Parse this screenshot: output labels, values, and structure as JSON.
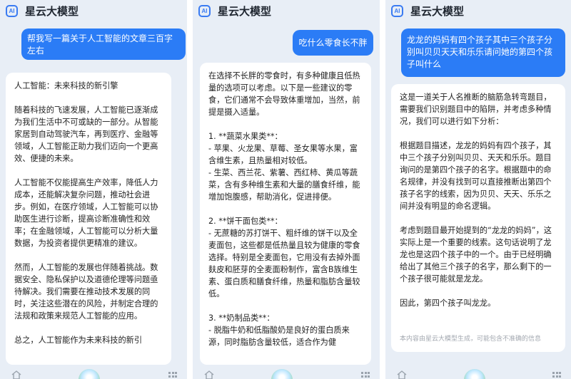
{
  "app": {
    "title": "星云大模型",
    "icon_text": "AI"
  },
  "panels": [
    {
      "prompt": "帮我写一篇关于人工智能的文章三百字\n左右",
      "answer": "人工智能：未来科技的新引擎\n\n随着科技的飞速发展，人工智能已逐渐成为我们生活中不可或缺的一部分。从智能家居到自动驾驶汽车，再到医疗、金融等领域，人工智能正助力我们迈向一个更高效、便捷的未来。\n\n人工智能不仅能提高生产效率，降低人力成本，还能解决复杂问题，推动社会进步。例如，在医疗领域，人工智能可以协助医生进行诊断，提高诊断准确性和效率；在金融领域，人工智能可以分析大量数据，为投资者提供更精准的建议。\n\n然而，人工智能的发展也伴随着挑战。数据安全、隐私保护以及道德伦理等问题亟待解决。我们需要在推动技术发展的同时，关注这些潜在的风险，并制定合理的法规和政策来规范人工智能的应用。\n\n总之，人工智能作为未来科技的新引"
    },
    {
      "prompt": "吃什么零食长不胖",
      "answer": "在选择不长胖的零食时，有多种健康且低热量的选项可以考虑。以下是一些建议的零食，它们通常不会导致体重增加，当然，前提是摄入适量。\n\n1. **蔬菜水果类**：\n  - 苹果、火龙果、草莓、圣女果等水果，富含维生素，且热量相对较低。\n  - 生菜、西兰花、紫薯、西红柿、黄瓜等蔬菜，含有多种维生素和大量的膳食纤维，能增加饱腹感，帮助消化，促进排便。\n\n2. **饼干面包类**：\n  - 无蔗糖的苏打饼干、粗纤维的饼干以及全麦面包，这些都是低热量且较为健康的零食选择。特别是全麦面包，它用没有去掉外面麸皮和胚芽的全麦面粉制作，富含B族维生素、蛋白质和膳食纤维，热量和脂肪含量较低。\n\n3. **奶制品类**：\n  - 脱脂牛奶和低脂酸奶是良好的蛋白质来源，同时脂肪含量较低，适合作为健"
    },
    {
      "prompt": "龙龙的妈妈有四个孩子其中三个孩子分别叫贝贝天天和乐乐请问她的第四个孩子叫什么",
      "answer": "这是一道关于人名推断的脑筋急转弯题目，需要我们识别题目中的陷阱，并考虑多种情况，我们可以进行如下分析：\n\n根据题目描述，龙龙的妈妈有四个孩子，其中三个孩子分别叫贝贝、天天和乐乐。题目询问的是第四个孩子的名字。根据题中的命名规律，并没有找到可以直接推断出第四个孩子名字的线索，因为贝贝、天天、乐乐之间并没有明显的命名逻辑。\n\n考虑到题目最开始提到的“龙龙的妈妈”，这实际上是一个重要的线索。这句话说明了龙龙也是这四个孩子中的一个。由于已经明确给出了其他三个孩子的名字，那么剩下的一个孩子很可能就是龙龙。\n\n因此，第四个孩子叫龙龙。",
      "disclaimer": "本内容由星云大模型生成，可能包含不准确的信息"
    }
  ],
  "colors": {
    "bubble": "#2b7cf6",
    "background": "#e8eef6",
    "card": "#ffffff"
  },
  "icons": [
    "app-logo-icon",
    "home-icon",
    "assistant-orb-icon",
    "keyboard-grid-icon"
  ]
}
